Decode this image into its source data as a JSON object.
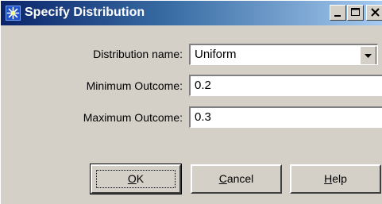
{
  "window": {
    "title": "Specify Distribution",
    "controls": {
      "minimize": "minimize",
      "maximize": "maximize",
      "close": "close"
    }
  },
  "form": {
    "distribution_name": {
      "label": "Distribution name:",
      "value": "Uniform"
    },
    "minimum_outcome": {
      "label": "Minimum Outcome:",
      "value": "0.2"
    },
    "maximum_outcome": {
      "label": "Maximum Outcome:",
      "value": "0.3"
    }
  },
  "buttons": {
    "ok_prefix": "",
    "ok_mnemonic": "O",
    "ok_rest": "K",
    "cancel_prefix": "",
    "cancel_mnemonic": "C",
    "cancel_rest": "ancel",
    "help_prefix": "",
    "help_mnemonic": "H",
    "help_rest": "elp"
  },
  "icons": {
    "app": "star-burst-icon",
    "dropdown": "chevron-down-icon"
  },
  "colors": {
    "titlebar_start": "#0a246a",
    "titlebar_end": "#a6caf0",
    "face": "#d4d0c8"
  }
}
